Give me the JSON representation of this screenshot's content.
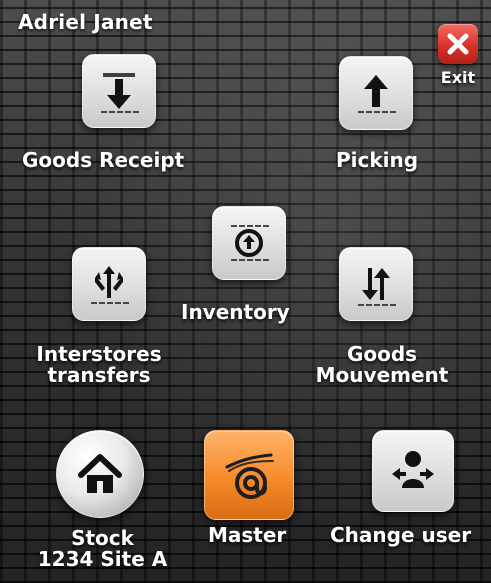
{
  "header": {
    "user_name": "Adriel Janet",
    "exit_label": "Exit"
  },
  "tiles": {
    "goods_receipt": {
      "label": "Goods Receipt",
      "icon": "down-arrow-icon"
    },
    "picking": {
      "label": "Picking",
      "icon": "up-arrow-icon"
    },
    "inventory": {
      "label": "Inventory",
      "icon": "target-icon"
    },
    "interstores_transfers": {
      "label_lines": [
        "Interstores",
        "transfers"
      ],
      "icon": "branching-arrows-icon"
    },
    "goods_mouvement": {
      "label_lines": [
        "Goods",
        "Mouvement"
      ],
      "icon": "swap-arrows-icon"
    },
    "stock": {
      "label_lines": [
        "Stock",
        "1234 Site A"
      ],
      "icon": "home-icon"
    },
    "master": {
      "label": "Master",
      "icon": "at-sign-icon"
    },
    "change_user": {
      "label": "Change user",
      "icon": "user-icon"
    }
  },
  "colors": {
    "exit_red": "#d7322a",
    "master_orange": "#f58b2a",
    "text": "#ffffff"
  }
}
